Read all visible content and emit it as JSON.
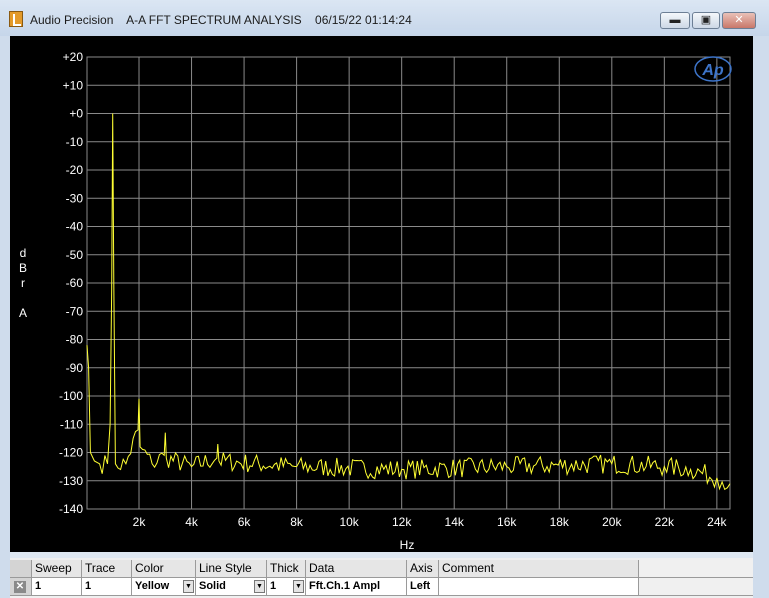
{
  "window": {
    "app_name": "Audio Precision",
    "title": "A-A FFT SPECTRUM ANALYSIS",
    "timestamp": "06/15/22 01:14:24",
    "minimize_icon": "minimize-icon",
    "maximize_icon": "maximize-icon",
    "close_icon": "close-icon",
    "minimize_glyph": "▬",
    "maximize_glyph": "▣",
    "close_glyph": "✕"
  },
  "graph": {
    "logo": "Ap",
    "ylabel_lines": [
      "d",
      "B",
      "r",
      "",
      "A"
    ],
    "colors": {
      "background": "#000000",
      "grid": "#8a8a8a",
      "trace": "#ffff33",
      "text": "#ffffff",
      "logo": "#3d74c9"
    }
  },
  "chart_data": {
    "type": "line",
    "title": "",
    "xlabel": "Hz",
    "ylabel": "dBr A",
    "xlim": [
      20,
      24500
    ],
    "ylim": [
      -140,
      20
    ],
    "grid": true,
    "y_ticks": [
      20,
      10,
      0,
      -10,
      -20,
      -30,
      -40,
      -50,
      -60,
      -70,
      -80,
      -90,
      -100,
      -110,
      -120,
      -130,
      -140
    ],
    "y_tick_labels": [
      "+20",
      "+10",
      "+0",
      "-10",
      "-20",
      "-30",
      "-40",
      "-50",
      "-60",
      "-70",
      "-80",
      "-90",
      "-100",
      "-110",
      "-120",
      "-130",
      "-140"
    ],
    "x_ticks": [
      2000,
      4000,
      6000,
      8000,
      10000,
      12000,
      14000,
      16000,
      18000,
      20000,
      22000,
      24000
    ],
    "x_tick_labels": [
      "2k",
      "4k",
      "6k",
      "8k",
      "10k",
      "12k",
      "14k",
      "16k",
      "18k",
      "20k",
      "22k",
      "24k"
    ],
    "series": [
      {
        "color": "#ffff33",
        "noise_floor": -125,
        "x": [
          20,
          80,
          150,
          300,
          500,
          800,
          900,
          960,
          1000,
          1040,
          1100,
          1500,
          1960,
          2000,
          2040,
          2500,
          2960,
          3000,
          3040,
          4000,
          4960,
          5000,
          5040,
          8000,
          12000,
          16000,
          20000,
          22000,
          23000,
          24000,
          24500
        ],
        "y": [
          -82,
          -90,
          -120,
          -123,
          -124,
          -124,
          -110,
          -62,
          0,
          -60,
          -124,
          -124,
          -112,
          -101,
          -118,
          -124,
          -121,
          -113,
          -122,
          -125,
          -122,
          -117,
          -123,
          -125,
          -126,
          -125,
          -124,
          -125,
          -126,
          -129,
          -131
        ]
      }
    ]
  },
  "table": {
    "headers": [
      "Sweep",
      "Trace",
      "Color",
      "Line Style",
      "Thick",
      "Data",
      "Axis",
      "Comment"
    ],
    "row": {
      "checked_glyph": "✕",
      "sweep": "1",
      "trace": "1",
      "color": "Yellow",
      "line_style": "Solid",
      "thick": "1",
      "data": "Fft.Ch.1 Ampl",
      "axis": "Left",
      "comment": ""
    },
    "dropdown_icon": "dropdown-arrow-icon",
    "dropdown_glyph": "▼"
  }
}
